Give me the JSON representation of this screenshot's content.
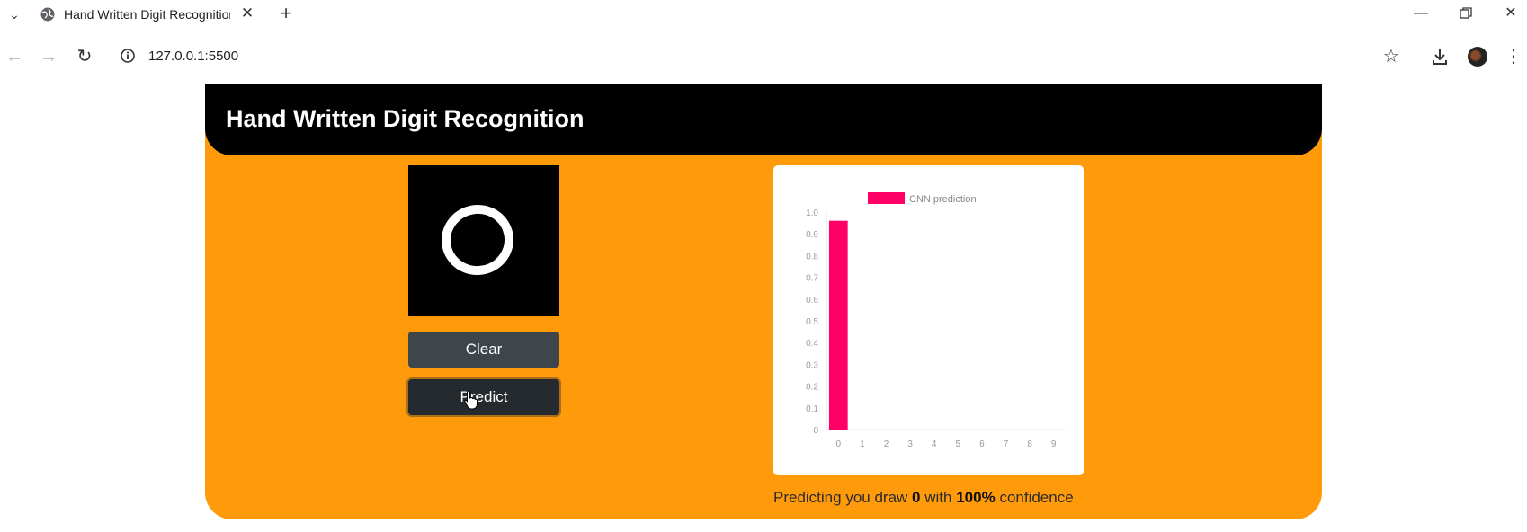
{
  "browser": {
    "tab_title": "Hand Written Digit Recognition",
    "url": "127.0.0.1:5500"
  },
  "page": {
    "header_title": "Hand Written Digit Recognition",
    "clear_label": "Clear",
    "predict_label": "Predict",
    "result_prefix": "Predicting you draw",
    "predicted_digit": "0",
    "result_mid": "with",
    "confidence": "100%",
    "result_suffix": "confidence"
  },
  "colors": {
    "page_bg": "#ff9b0b",
    "header_bg": "#000000",
    "bar": "#ff0066"
  },
  "chart_data": {
    "type": "bar",
    "categories": [
      "0",
      "1",
      "2",
      "3",
      "4",
      "5",
      "6",
      "7",
      "8",
      "9"
    ],
    "series": [
      {
        "name": "CNN prediction",
        "values": [
          0.96,
          0,
          0,
          0,
          0,
          0,
          0,
          0,
          0,
          0
        ]
      }
    ],
    "ylim": [
      0,
      1.0
    ],
    "yticks": [
      "1.0",
      "0.9",
      "0.8",
      "0.7",
      "0.6",
      "0.5",
      "0.4",
      "0.3",
      "0.2",
      "0.1",
      "0"
    ],
    "legend": "top",
    "grid": false
  }
}
